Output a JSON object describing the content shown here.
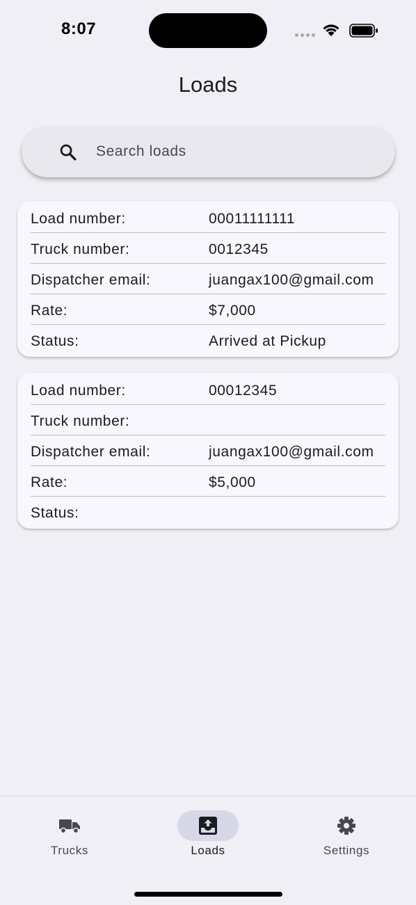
{
  "status_bar": {
    "time": "8:07"
  },
  "header": {
    "title": "Loads"
  },
  "search": {
    "placeholder": "Search loads",
    "value": ""
  },
  "loads": [
    {
      "rows": [
        {
          "label": "Load number:",
          "value": "00011111111"
        },
        {
          "label": "Truck number:",
          "value": "0012345"
        },
        {
          "label": "Dispatcher email:",
          "value": "juangax100@gmail.com"
        },
        {
          "label": "Rate:",
          "value": "$7,000"
        },
        {
          "label": "Status:",
          "value": "Arrived at Pickup"
        }
      ]
    },
    {
      "rows": [
        {
          "label": "Load number:",
          "value": "00012345"
        },
        {
          "label": "Truck number:",
          "value": ""
        },
        {
          "label": "Dispatcher email:",
          "value": "juangax100@gmail.com"
        },
        {
          "label": "Rate:",
          "value": "$5,000"
        },
        {
          "label": "Status:",
          "value": ""
        }
      ]
    }
  ],
  "bottom_nav": {
    "items": [
      {
        "label": "Trucks",
        "icon": "truck-icon"
      },
      {
        "label": "Loads",
        "icon": "inbox-upload-icon",
        "selected": true
      },
      {
        "label": "Settings",
        "icon": "gear-icon"
      }
    ]
  },
  "colors": {
    "background": "#f0eff5",
    "card": "#f8f7fd",
    "selected_nav_pill": "#d6d8e8",
    "text": "#1c1b20"
  }
}
